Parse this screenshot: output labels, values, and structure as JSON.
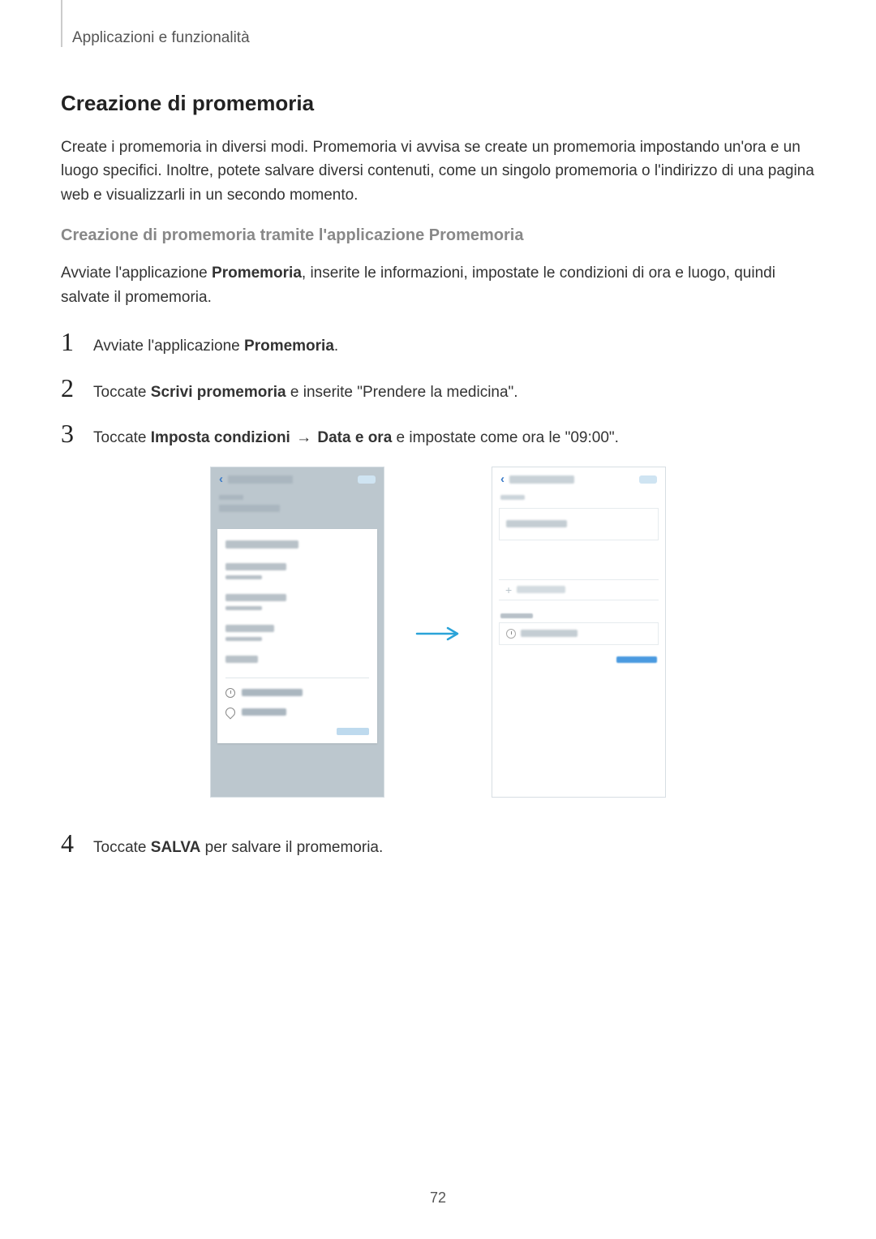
{
  "breadcrumb": "Applicazioni e funzionalità",
  "title": "Creazione di promemoria",
  "intro": "Create i promemoria in diversi modi. Promemoria vi avvisa se create un promemoria impostando un'ora e un luogo specifici. Inoltre, potete salvare diversi contenuti, come un singolo promemoria o l'indirizzo di una pagina web e visualizzarli in un secondo momento.",
  "subtitle": "Creazione di promemoria tramite l'applicazione Promemoria",
  "intro2_part1": "Avviate l'applicazione ",
  "intro2_bold": "Promemoria",
  "intro2_part2": ", inserite le informazioni, impostate le condizioni di ora e luogo, quindi salvate il promemoria.",
  "steps": {
    "s1_num": "1",
    "s1_p1": "Avviate l'applicazione ",
    "s1_b1": "Promemoria",
    "s1_p2": ".",
    "s2_num": "2",
    "s2_p1": "Toccate ",
    "s2_b1": "Scrivi promemoria",
    "s2_p2": " e inserite \"Prendere la medicina\".",
    "s3_num": "3",
    "s3_p1": "Toccate ",
    "s3_b1": "Imposta condizioni",
    "s3_arrow": " → ",
    "s3_b2": "Data e ora",
    "s3_p2": " e impostate come ora le \"09:00\".",
    "s4_num": "4",
    "s4_p1": "Toccate ",
    "s4_b1": "SALVA",
    "s4_p2": " per salvare il promemoria."
  },
  "page_number": "72"
}
